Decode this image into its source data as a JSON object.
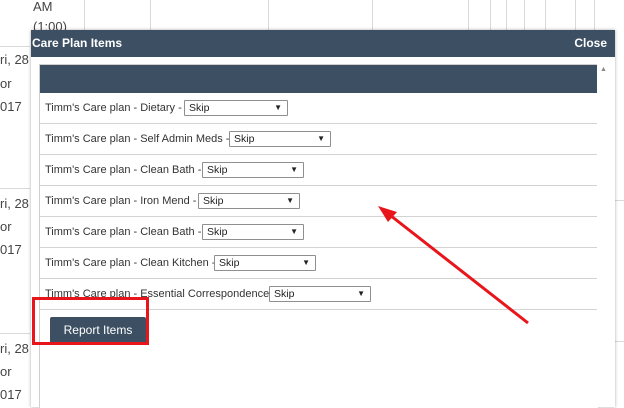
{
  "background": {
    "time_label": "AM",
    "time_sub": "(1:00)",
    "days": [
      {
        "line1": "ri, 28",
        "line2": "or",
        "line3": "017"
      },
      {
        "line1": "ri, 28",
        "line2": "or",
        "line3": "017"
      },
      {
        "line1": "ri, 28",
        "line2": "or",
        "line3": "017"
      }
    ]
  },
  "modal": {
    "title": "Care Plan Items",
    "close_label": "Close",
    "items": [
      {
        "label": "Timm's Care plan - Dietary - -",
        "selected": "Skip"
      },
      {
        "label": "Timm's Care plan - Self Admin Meds - -",
        "selected": "Skip"
      },
      {
        "label": "Timm's Care plan - Clean Bath - -",
        "selected": "Skip"
      },
      {
        "label": "Timm's Care plan - Iron Mend - -",
        "selected": "Skip"
      },
      {
        "label": "Timm's Care plan - Clean Bath - -",
        "selected": "Skip"
      },
      {
        "label": "Timm's Care plan - Clean Kitchen - -",
        "selected": "Skip"
      },
      {
        "label": "Timm's Care plan - Essential Correspondence - -",
        "selected": "Skip"
      }
    ],
    "report_button_label": "Report Items"
  },
  "colors": {
    "header": "#3c4f63",
    "annotation": "#e8151b"
  },
  "icons": {
    "dropdown": "chevron-down-icon",
    "scroll_up": "scroll-up-icon"
  }
}
